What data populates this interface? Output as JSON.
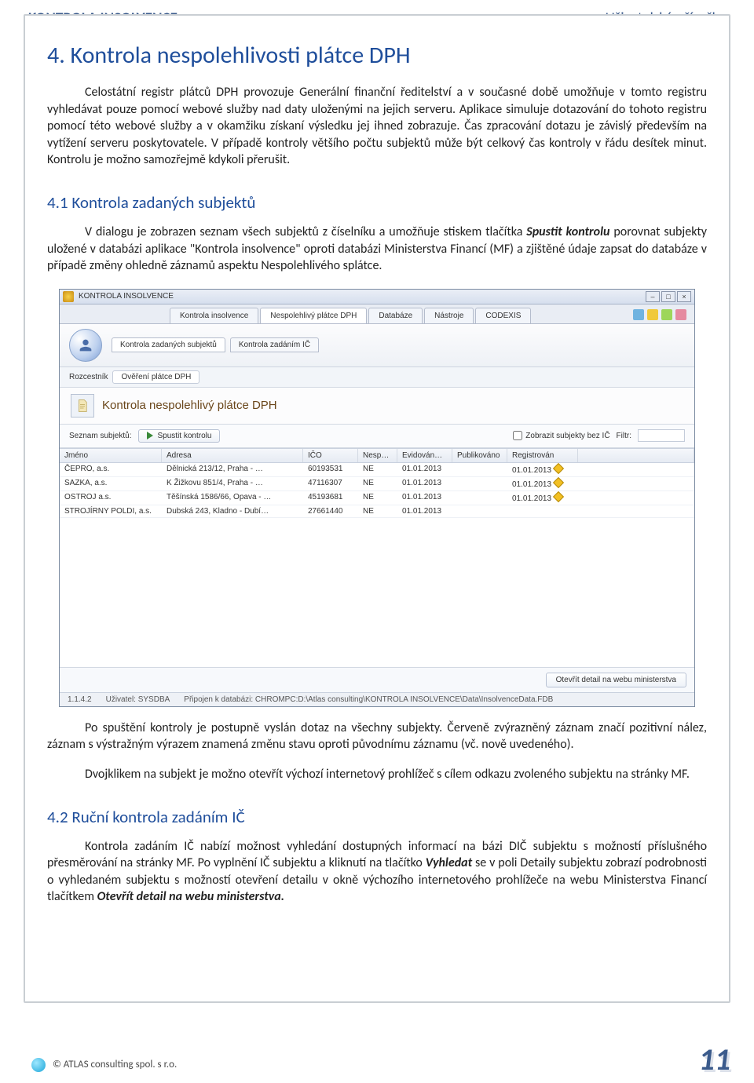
{
  "header": {
    "left": "KONTROLA INSOLVENCE",
    "right": "Uživatelská příručka"
  },
  "title": "4. Kontrola nespolehlivosti plátce DPH",
  "intro": "Celostátní registr plátců DPH provozuje Generální finanční ředitelství a v současné době umožňuje v tomto registru vyhledávat pouze pomocí webové služby nad daty uloženými na jejich serveru. Aplikace simuluje dotazování do tohoto registru pomocí této webové služby a v okamžiku získaní výsledku jej ihned zobrazuje. Čas zpracování dotazu je závislý především na vytížení serveru poskytovatele. V případě kontroly většího počtu subjektů může být celkový čas kontroly v řádu desítek minut. Kontrolu je možno samozřejmě kdykoli přerušit.",
  "section41_title": "4.1 Kontrola zadaných subjektů",
  "section41_lead": "V dialogu je zobrazen seznam všech subjektů z číselníku a umožňuje stiskem tlačítka ",
  "section41_bold1": "Spustit kontrolu",
  "section41_rest": " porovnat subjekty uložené v databázi aplikace \"Kontrola insolvence\" oproti databázi Ministerstva Financí (MF) a zjištěné údaje zapsat do databáze v případě změny ohledně záznamů aspektu Nespolehlivého splátce.",
  "after1": "Po spuštění kontroly je postupně vyslán dotaz na všechny subjekty. Červeně zvýrazněný záznam značí pozitivní nález, záznam s výstražným výrazem znamená změnu stavu oproti původnímu záznamu (vč. nově uvedeného).",
  "after2": "Dvojklikem na subjekt je možno otevřít výchozí internetový prohlížeč s cílem odkazu zvoleného subjektu na stránky MF.",
  "section42_title": "4.2 Ruční kontrola zadáním IČ",
  "section42_lead": "Kontrola zadáním IČ nabízí možnost vyhledání dostupných informací na bázi DIČ subjektu s možností příslušného přesměrování na stránky MF. Po vyplnění IČ subjektu a kliknutí na tlačítko ",
  "section42_bold1": "Vyhledat",
  "section42_mid": " se v poli Detaily subjektu zobrazí podrobnosti o vyhledaném subjektu s možností otevření detailu v okně výchozího internetového prohlížeče na webu Ministerstva Financí tlačítkem ",
  "section42_bold2": "Otevřít detail na webu ministerstva.",
  "footer": "© ATLAS consulting spol. s r.o.",
  "page_number": "11",
  "app": {
    "window_title": "KONTROLA INSOLVENCE",
    "main_tabs": [
      "Kontrola insolvence",
      "Nespolehlivý plátce DPH",
      "Databáze",
      "Nástroje",
      "CODEXIS"
    ],
    "sub_tabs": [
      "Kontrola zadaných subjektů",
      "Kontrola zadáním IČ"
    ],
    "crumb_label": "Rozcestník",
    "crumb_chip": "Ověření plátce DPH",
    "panel_title": "Kontrola nespolehlivý plátce DPH",
    "list_label": "Seznam subjektů:",
    "run_button": "Spustit kontrolu",
    "show_without_ic": "Zobrazit subjekty bez IČ",
    "filter_label": "Filtr:",
    "columns": [
      "Jméno",
      "Adresa",
      "IČO",
      "Nesp…",
      "Evidován…",
      "Publikováno",
      "Registrován",
      ""
    ],
    "rows": [
      {
        "name": "ČEPRO, a.s.",
        "addr": "Dělnická 213/12, Praha - …",
        "ico": "60193531",
        "nesp": "NE",
        "ev": "01.01.2013",
        "pub": "",
        "reg": "01.01.2013",
        "warn": true
      },
      {
        "name": "SAZKA, a.s.",
        "addr": "K Žižkovu 851/4, Praha - …",
        "ico": "47116307",
        "nesp": "NE",
        "ev": "01.01.2013",
        "pub": "",
        "reg": "01.01.2013",
        "warn": true
      },
      {
        "name": "OSTROJ a.s.",
        "addr": "Těšínská 1586/66, Opava - …",
        "ico": "45193681",
        "nesp": "NE",
        "ev": "01.01.2013",
        "pub": "",
        "reg": "01.01.2013",
        "warn": true
      },
      {
        "name": "STROJÍRNY POLDI, a.s.",
        "addr": "Dubská 243, Kladno - Dubí…",
        "ico": "27661440",
        "nesp": "NE",
        "ev": "01.01.2013",
        "pub": "",
        "reg": "",
        "warn": false
      }
    ],
    "open_detail_btn": "Otevřít detail na webu ministerstva",
    "status_version": "1.1.4.2",
    "status_user": "Uživatel: SYSDBA",
    "status_conn": "Připojen k databázi: CHROMPC:D:\\Atlas consulting\\KONTROLA INSOLVENCE\\Data\\InsolvenceData.FDB"
  }
}
